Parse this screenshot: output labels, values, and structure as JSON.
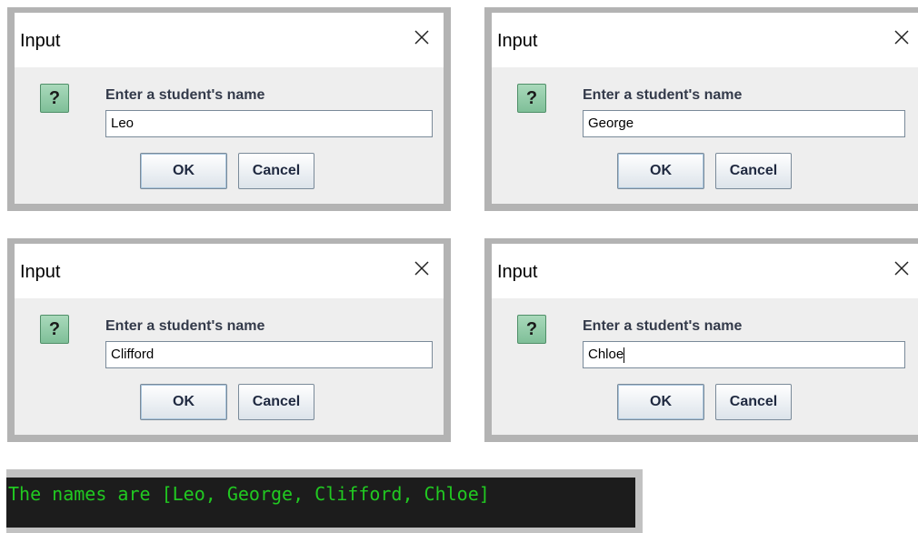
{
  "dialogs": [
    {
      "title": "Input",
      "prompt": "Enter a student's name",
      "value": "Leo",
      "ok_label": "OK",
      "cancel_label": "Cancel",
      "icon": "question-icon",
      "icon_glyph": "?"
    },
    {
      "title": "Input",
      "prompt": "Enter a student's name",
      "value": "George",
      "ok_label": "OK",
      "cancel_label": "Cancel",
      "icon": "question-icon",
      "icon_glyph": "?"
    },
    {
      "title": "Input",
      "prompt": "Enter a student's name",
      "value": "Clifford",
      "ok_label": "OK",
      "cancel_label": "Cancel",
      "icon": "question-icon",
      "icon_glyph": "?"
    },
    {
      "title": "Input",
      "prompt": "Enter a student's name",
      "value": "Chloe",
      "ok_label": "OK",
      "cancel_label": "Cancel",
      "icon": "question-icon",
      "icon_glyph": "?"
    }
  ],
  "console": {
    "output": "The names are [Leo, George, Clifford, Chloe]",
    "text_color": "#21c921",
    "background_color": "#1c1c1c"
  },
  "colors": {
    "frame": "#b3b3b3",
    "dialog_body": "#eeeeee",
    "icon_green": "#7fbf98"
  }
}
